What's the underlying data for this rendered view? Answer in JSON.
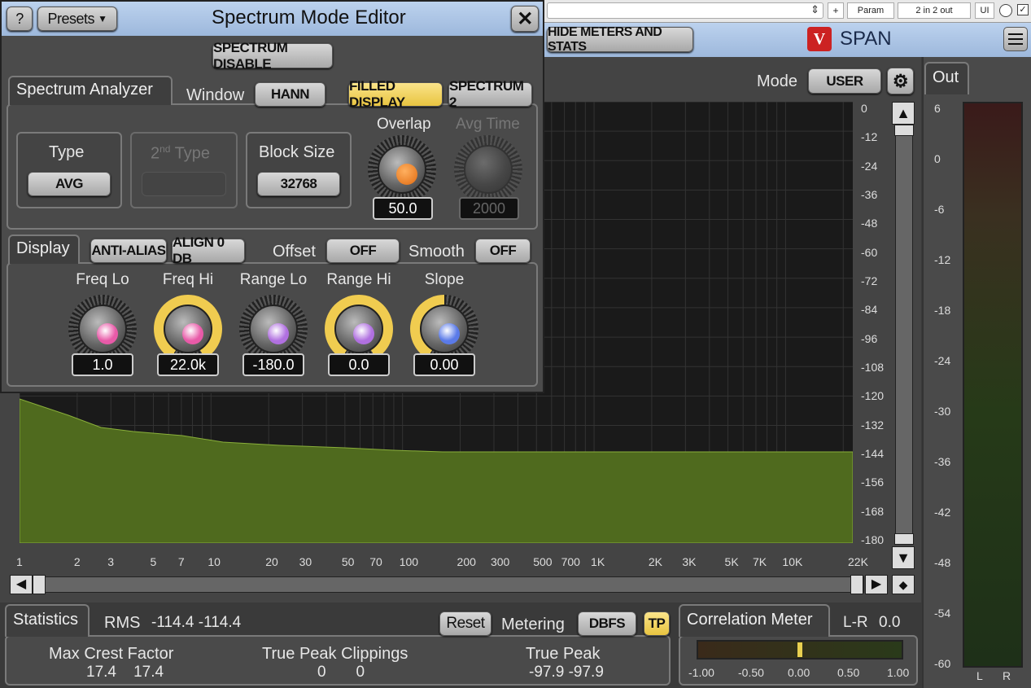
{
  "host": {
    "param_label": "Param",
    "io_label": "2 in 2 out",
    "ui_label": "UI",
    "plus_label": "+"
  },
  "plugin": {
    "hide_meters_button": "HIDE METERS AND STATS",
    "brand": "SPAN",
    "mode_label": "Mode",
    "mode_value": "USER",
    "out_tab": "Out"
  },
  "editor": {
    "title": "Spectrum Mode Editor",
    "help_button": "?",
    "presets_button": "Presets",
    "close_icon": "close-icon",
    "spectrum_disable": "SPECTRUM DISABLE",
    "analyzer_tab": "Spectrum Analyzer",
    "window_label": "Window",
    "window_value": "HANN",
    "filled_display": "FILLED DISPLAY",
    "spectrum2": "SPECTRUM 2",
    "type_label": "Type",
    "type_value": "AVG",
    "type2_label": "2nd Type",
    "type2_sup": "nd",
    "type2_prefix": "2",
    "type2_suffix": " Type",
    "block_label": "Block Size",
    "block_value": "32768",
    "overlap_label": "Overlap",
    "overlap_value": "50.0",
    "avg_label": "Avg Time",
    "avg_value": "2000",
    "display_tab": "Display",
    "anti_alias": "ANTI-ALIAS",
    "align_0db": "ALIGN 0 DB",
    "offset_label": "Offset",
    "offset_value": "OFF",
    "smooth_label": "Smooth",
    "smooth_value": "OFF",
    "knobs": [
      {
        "label": "Freq Lo",
        "value": "1.0",
        "color": "#e85aa8",
        "level": 0
      },
      {
        "label": "Freq Hi",
        "value": "22.0k",
        "color": "#e85aa8",
        "level": 1
      },
      {
        "label": "Range Lo",
        "value": "-180.0",
        "color": "#b070e0",
        "level": 0
      },
      {
        "label": "Range Hi",
        "value": "0.0",
        "color": "#b070e0",
        "level": 1
      },
      {
        "label": "Slope",
        "value": "0.00",
        "color": "#5a7ae8",
        "level": 0.5
      }
    ]
  },
  "spectrum": {
    "db_ticks": [
      "0",
      "-12",
      "-24",
      "-36",
      "-48",
      "-60",
      "-72",
      "-84",
      "-96",
      "-108",
      "-120",
      "-132",
      "-144",
      "-156",
      "-168",
      "-180"
    ],
    "freq_ticks": [
      "1",
      "2",
      "3",
      "5",
      "7",
      "10",
      "20",
      "30",
      "50",
      "70",
      "100",
      "200",
      "300",
      "500",
      "700",
      "1K",
      "2K",
      "3K",
      "5K",
      "7K",
      "10K",
      "22K"
    ]
  },
  "meter": {
    "ticks": [
      "6",
      "0",
      "-6",
      "-12",
      "-18",
      "-24",
      "-30",
      "-36",
      "-42",
      "-48",
      "-54",
      "-60"
    ],
    "left": "L",
    "right": "R"
  },
  "stats": {
    "tab": "Statistics",
    "rms_label": "RMS",
    "rms_values": "-114.4  -114.4",
    "reset": "Reset",
    "metering_label": "Metering",
    "metering_value": "DBFS",
    "tp_button": "TP",
    "crest_label": "Max Crest Factor",
    "crest_values": "17.4    17.4",
    "clip_label": "True Peak Clippings",
    "clip_values": "0       0",
    "tp_label": "True Peak",
    "tp_values": "-97.9  -97.9"
  },
  "correlation": {
    "tab": "Correlation Meter",
    "lr_label": "L-R",
    "lr_value": "0.0",
    "ticks": [
      "-1.00",
      "-0.50",
      "0.00",
      "0.50",
      "1.00"
    ],
    "value": 0.0
  }
}
